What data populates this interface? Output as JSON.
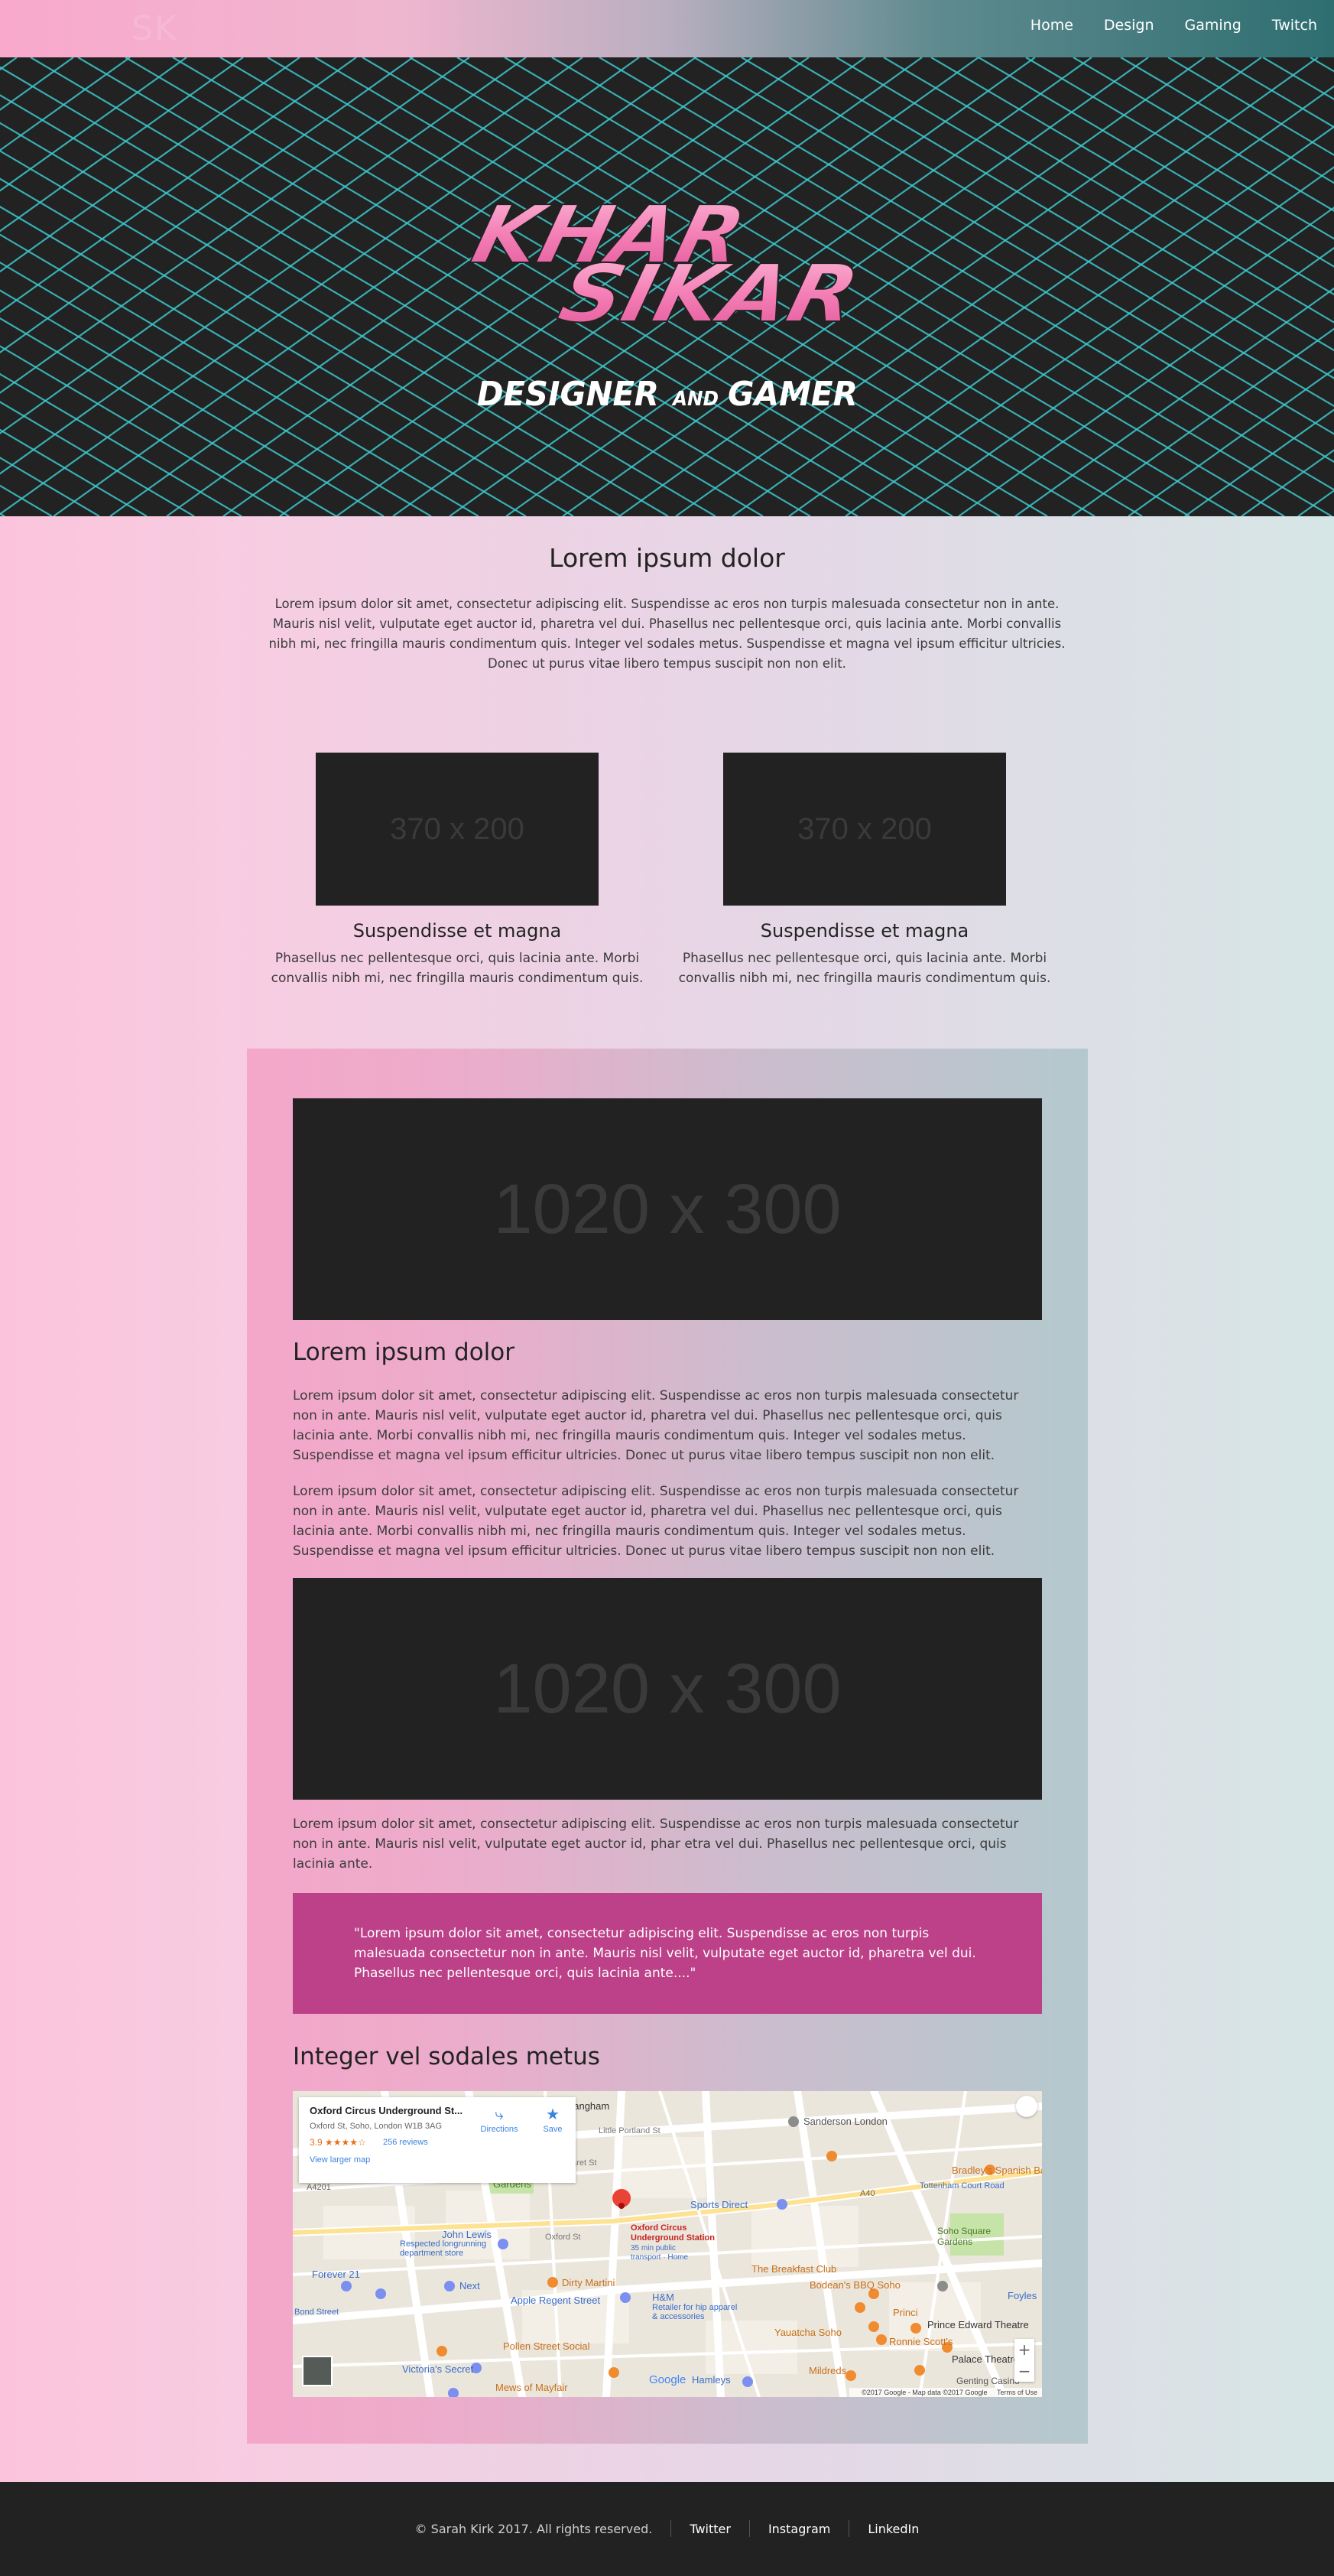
{
  "nav": {
    "logo": "SK",
    "links": [
      "Home",
      "Design",
      "Gaming",
      "Twitch"
    ]
  },
  "hero": {
    "title_line1": "KHAR",
    "title_line2": "SIKAR",
    "subtitle_left": "DESIGNER",
    "subtitle_and": "AND",
    "subtitle_right": "GAMER"
  },
  "intro": {
    "title": "Lorem ipsum dolor",
    "text": "Lorem ipsum dolor sit amet, consectetur adipiscing elit. Suspendisse ac eros non turpis malesuada consectetur non in ante. Mauris nisl velit, vulputate eget auctor id, pharetra vel dui. Phasellus nec pellentesque orci, quis lacinia ante. Morbi convallis nibh mi, nec fringilla mauris condimentum quis. Integer vel sodales metus. Suspendisse et magna vel ipsum efficitur ultricies. Donec ut purus vitae libero tempus suscipit non non elit."
  },
  "features": [
    {
      "image_label": "370 x 200",
      "title": "Suspendisse et magna",
      "text": "Phasellus nec pellentesque orci, quis lacinia ante. Morbi convallis nibh mi, nec fringilla mauris condimentum quis."
    },
    {
      "image_label": "370 x 200",
      "title": "Suspendisse et magna",
      "text": "Phasellus nec pellentesque orci, quis lacinia ante. Morbi convallis nibh mi, nec fringilla mauris condimentum quis."
    }
  ],
  "article": {
    "image1_label": "1020 x 300",
    "heading": "Lorem ipsum dolor",
    "paragraph1": "Lorem ipsum dolor sit amet, consectetur adipiscing elit. Suspendisse ac eros non turpis malesuada consectetur non in ante. Mauris nisl velit, vulputate eget auctor id, pharetra vel dui. Phasellus nec pellentesque orci, quis lacinia ante. Morbi convallis nibh mi, nec fringilla mauris condimentum quis. Integer vel sodales metus. Suspendisse et magna vel ipsum efficitur ultricies. Donec ut purus vitae libero tempus suscipit non non elit.",
    "paragraph2": "Lorem ipsum dolor sit amet, consectetur adipiscing elit. Suspendisse ac eros non turpis malesuada consectetur non in ante. Mauris nisl velit, vulputate eget auctor id, pharetra vel dui. Phasellus nec pellentesque orci, quis lacinia ante. Morbi convallis nibh mi, nec fringilla mauris condimentum quis. Integer vel sodales metus. Suspendisse et magna vel ipsum efficitur ultricies. Donec ut purus vitae libero tempus suscipit non non elit.",
    "image2_label": "1020 x 300",
    "paragraph3": "Lorem ipsum dolor sit amet, consectetur adipiscing elit. Suspendisse ac eros non turpis malesuada consectetur non in ante. Mauris nisl velit, vulputate eget auctor id, phar etra vel dui. Phasellus nec pellentesque orci, quis lacinia ante.",
    "quote": "\"Lorem ipsum dolor sit amet, consectetur adipiscing elit. Suspendisse ac eros non turpis malesuada consectetur non in ante. Mauris nisl velit, vulputate eget auctor id, pharetra vel dui. Phasellus nec pellentesque orci, quis lacinia ante....\"",
    "map_heading": "Integer vel sodales metus"
  },
  "map": {
    "place_name": "Oxford Circus Underground St...",
    "address": "Oxford St, Soho, London W1B 3AG",
    "rating": "3.9",
    "stars": "★★★★☆",
    "reviews": "256 reviews",
    "view_larger": "View larger map",
    "directions": "Directions",
    "save": "Save",
    "marker_title": "Oxford Circus Underground Station",
    "marker_subtitle": "35 min public transport · Home",
    "labels": [
      "Langham",
      "Sanderson London",
      "Gardens",
      "Bradley's Spanish Bar",
      "Tottenham Court Road",
      "Sports Direct",
      "Soho Square Gardens",
      "John Lewis",
      "Respected longrunning department store",
      "Next",
      "Dirty Martini",
      "The Breakfast Club",
      "Bodean's BBQ Soho",
      "H&M",
      "Retailer for hip apparel & accessories",
      "Apple Regent Street",
      "Yauatcha Soho",
      "Prince Edward Theatre",
      "Ronnie Scott's",
      "Palace Theatre",
      "Pollen Street Social",
      "Mildreds",
      "Victoria's Secret",
      "Hamleys",
      "Mews of Mayfair",
      "Genting Casino",
      "Foyles",
      "Forever 21",
      "Bond Street",
      "Princi",
      "A40",
      "A4201",
      "Oxford St",
      "Margaret St",
      "Little Portland St"
    ],
    "zoom_in": "+",
    "zoom_out": "−",
    "google": "Google",
    "attribution": "©2017 Google - Map data ©2017 Google",
    "terms": "Terms of Use"
  },
  "footer": {
    "copyright": "© Sarah Kirk 2017. All rights reserved.",
    "links": [
      "Twitter",
      "Instagram",
      "LinkedIn"
    ]
  },
  "colors": {
    "pink": "#f7a8ca",
    "teal": "#2e6e71",
    "dark": "#222222",
    "magenta": "#bc4188",
    "hero_lines": "#3ec7cc"
  }
}
